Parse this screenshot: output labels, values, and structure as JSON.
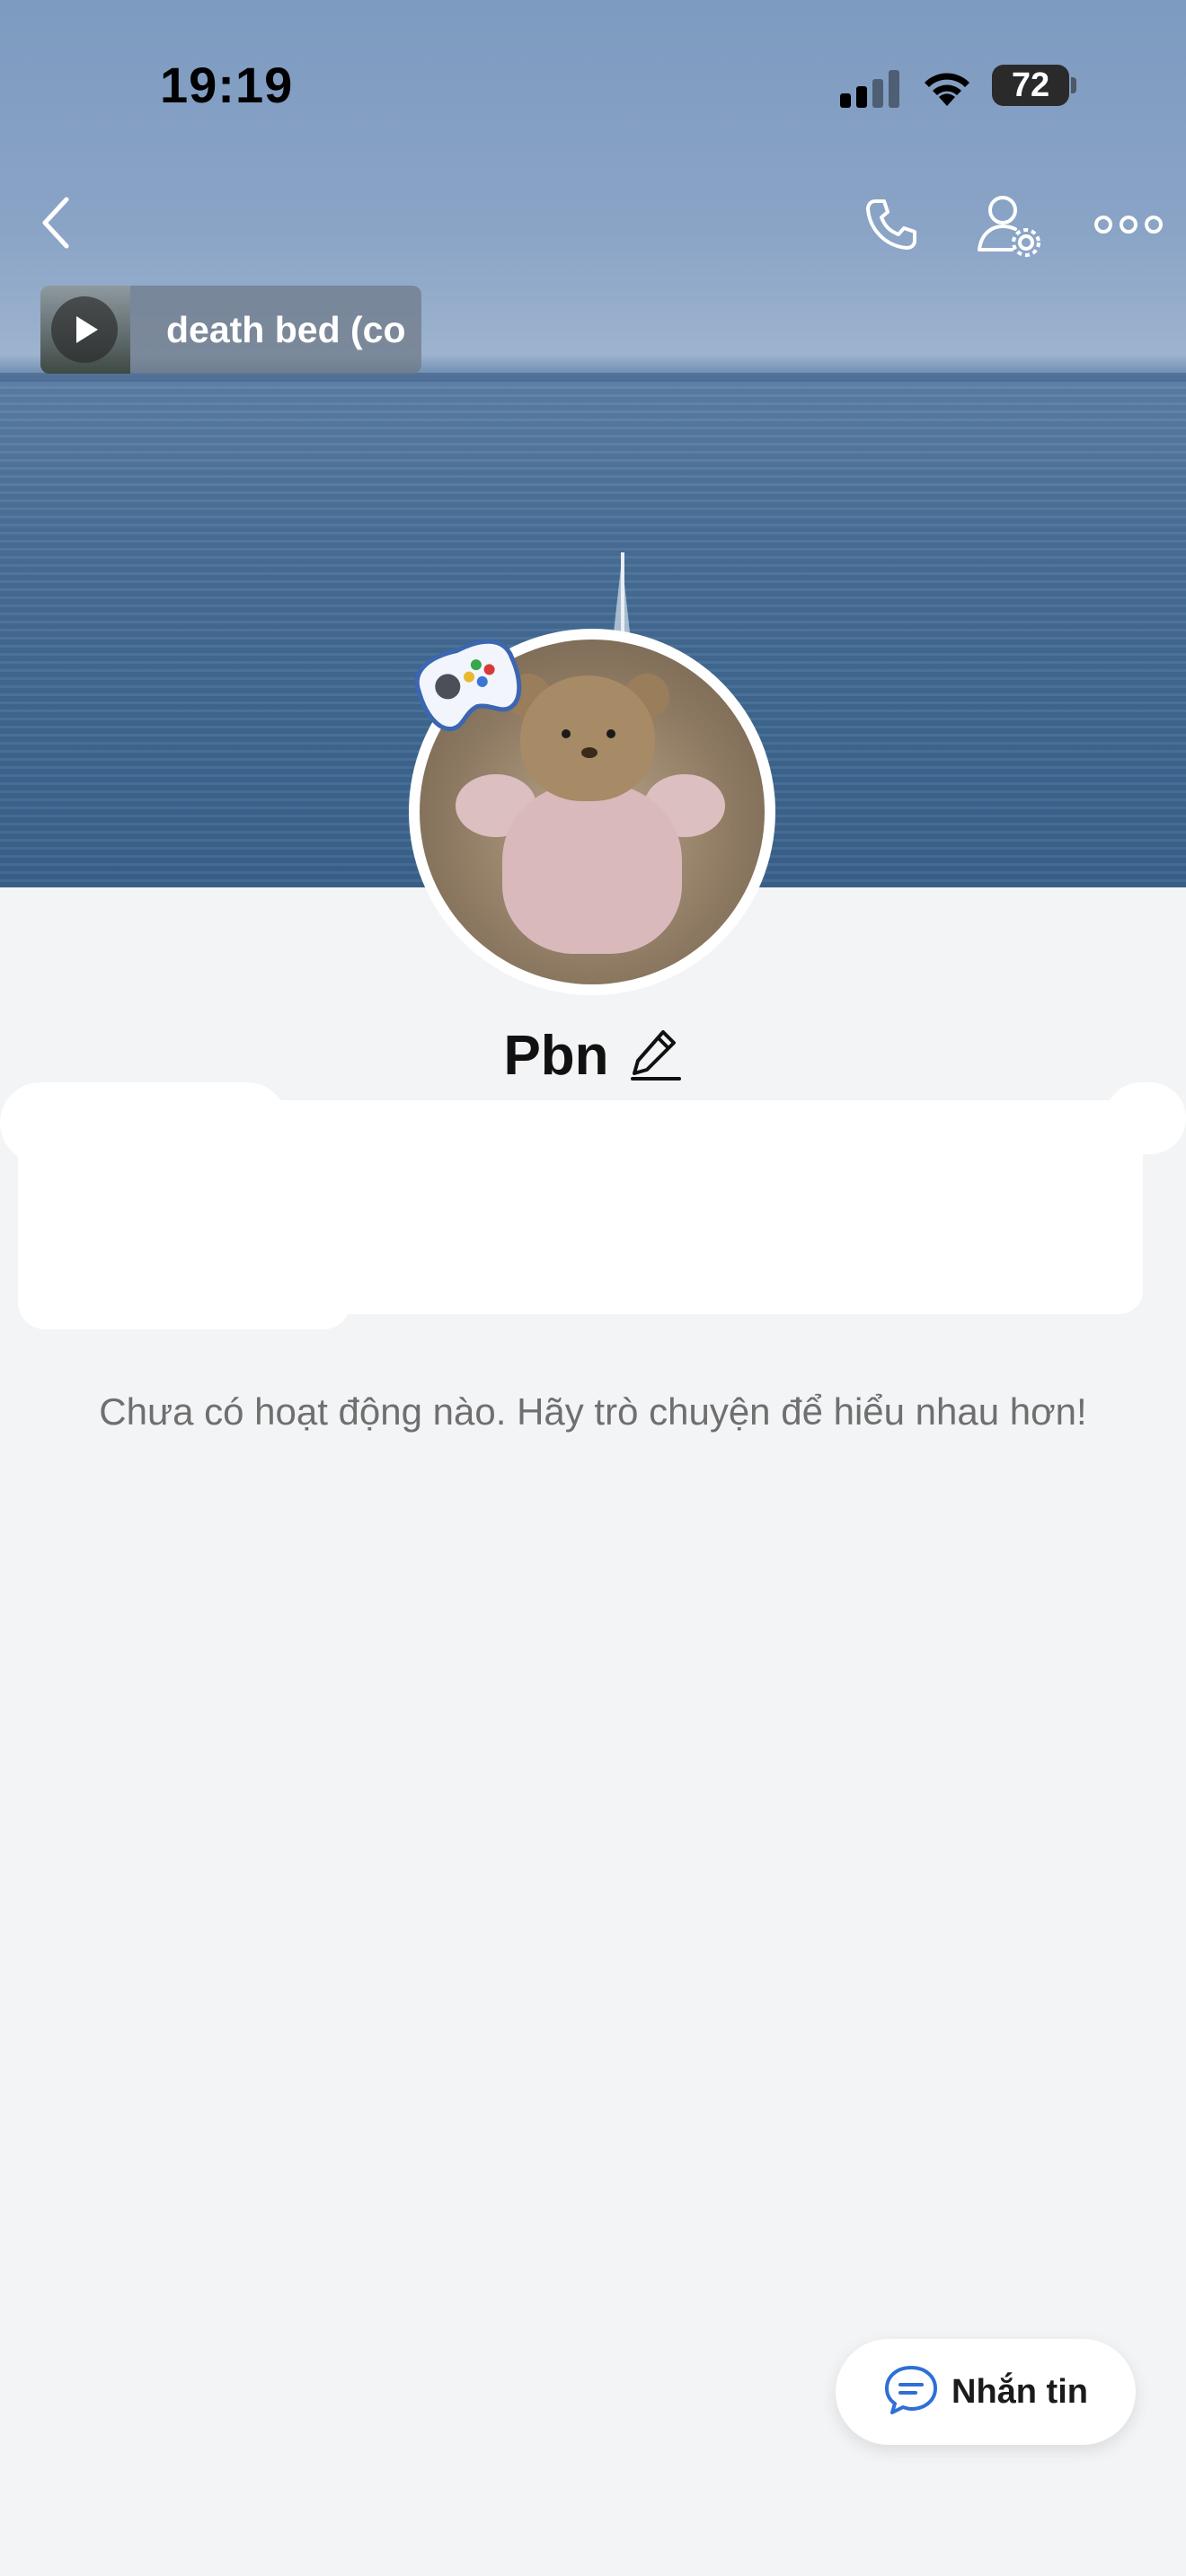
{
  "status_bar": {
    "time": "19:19",
    "battery": "72"
  },
  "header": {
    "icons": [
      "chevron-left-icon",
      "phone-icon",
      "user-settings-icon",
      "more-horizontal-icon"
    ]
  },
  "music": {
    "title": "death bed (co"
  },
  "profile": {
    "name": "Pbn",
    "badge_icon": "gamepad-icon"
  },
  "feed": {
    "empty_text": "Chưa có hoạt động nào. Hãy trò chuyện để hiểu nhau hơn!"
  },
  "actions": {
    "message_label": "Nhắn tin",
    "message_icon": "chat-bubble-icon"
  },
  "colors": {
    "accent": "#2f6fd6",
    "background": "#f3f4f6"
  }
}
